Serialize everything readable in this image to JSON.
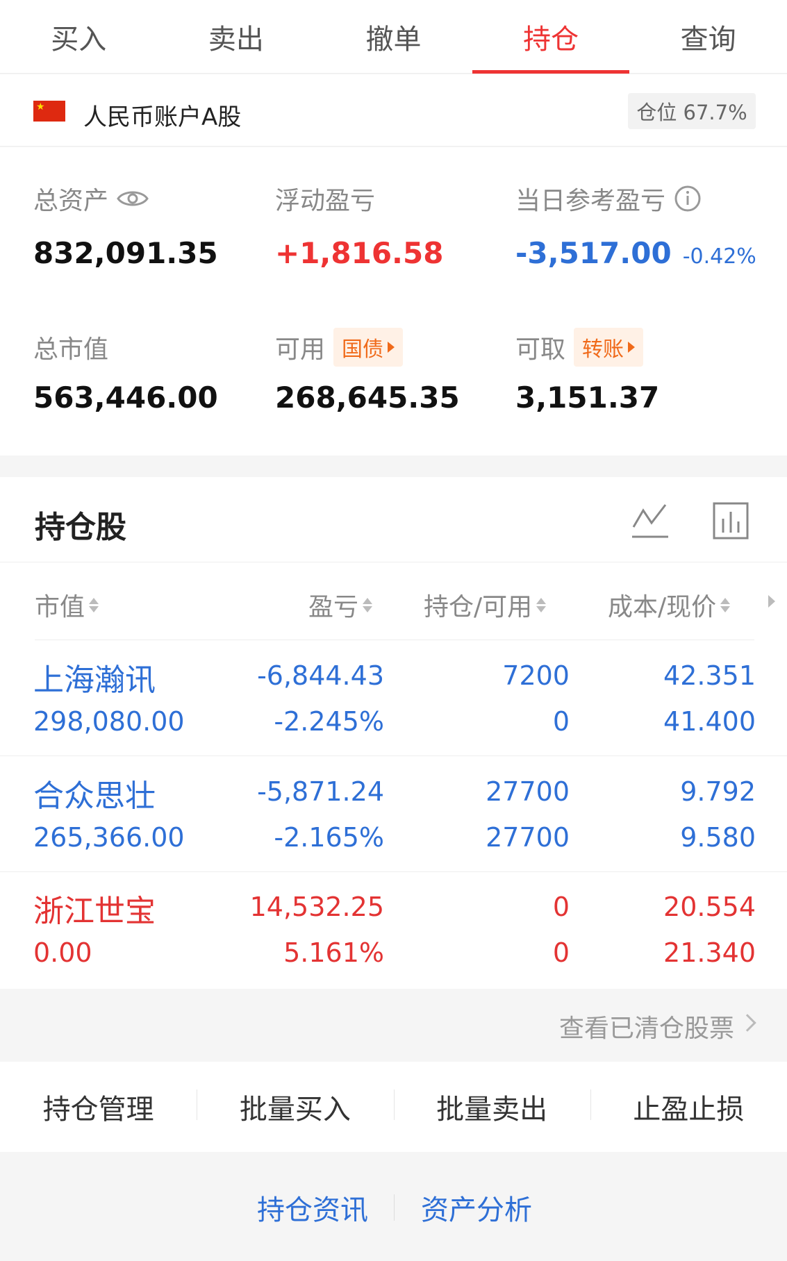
{
  "tabs": [
    "买入",
    "卖出",
    "撤单",
    "持仓",
    "查询"
  ],
  "account": {
    "name": "人民币账户A股",
    "position_label": "仓位 67.7%"
  },
  "summary": {
    "total_assets_label": "总资产",
    "total_assets": "832,091.35",
    "floating_pl_label": "浮动盈亏",
    "floating_pl": "+1,816.58",
    "today_pl_label": "当日参考盈亏",
    "today_pl": "-3,517.00",
    "today_pl_pct": "-0.42%",
    "market_value_label": "总市值",
    "market_value": "563,446.00",
    "available_label": "可用",
    "available_tag": "国债",
    "available": "268,645.35",
    "withdrawable_label": "可取",
    "withdrawable_tag": "转账",
    "withdrawable": "3,151.37"
  },
  "holdings": {
    "title": "持仓股",
    "columns": [
      "市值",
      "盈亏",
      "持仓/可用",
      "成本/现价"
    ],
    "rows": [
      {
        "name": "上海瀚讯",
        "market_value": "298,080.00",
        "pl": "-6,844.43",
        "pl_pct": "-2.245%",
        "position": "7200",
        "available": "0",
        "cost": "42.351",
        "price": "41.400",
        "color": "#2e6fd6"
      },
      {
        "name": "合众思壮",
        "market_value": "265,366.00",
        "pl": "-5,871.24",
        "pl_pct": "-2.165%",
        "position": "27700",
        "available": "27700",
        "cost": "9.792",
        "price": "9.580",
        "color": "#2e6fd6"
      },
      {
        "name": "浙江世宝",
        "market_value": "0.00",
        "pl": "14,532.25",
        "pl_pct": "5.161%",
        "position": "0",
        "available": "0",
        "cost": "20.554",
        "price": "21.340",
        "color": "#e33333"
      }
    ]
  },
  "cleared_link": "查看已清仓股票",
  "actions": [
    "持仓管理",
    "批量买入",
    "批量卖出",
    "止盈止损"
  ],
  "links": [
    "持仓资讯",
    "资产分析"
  ]
}
